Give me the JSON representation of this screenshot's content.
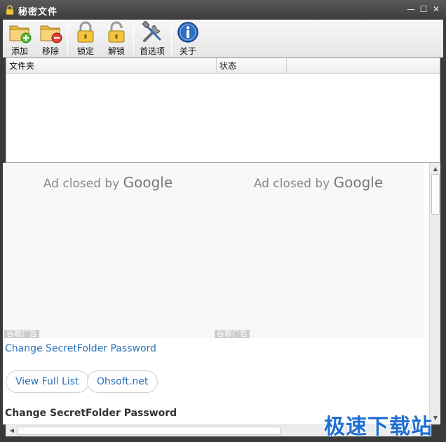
{
  "window": {
    "title": "秘密文件",
    "minimize": "—",
    "maximize": "☐",
    "close": "✕"
  },
  "toolbar": {
    "add_label": "添加",
    "remove_label": "移除",
    "lock_label": "锁定",
    "unlock_label": "解锁",
    "options_label": "首选项",
    "about_label": "关于"
  },
  "list": {
    "columns": [
      "文件夹",
      "状态"
    ],
    "rows": []
  },
  "web": {
    "ads": [
      {
        "text": "Ad closed by",
        "brand": "Google",
        "label": "谷歌广告"
      },
      {
        "text": "Ad closed by",
        "brand": "Google",
        "label": "谷歌广告"
      }
    ],
    "link_text": "Change SecretFolder Password",
    "buttons": [
      "View Full List",
      "Ohsoft.net"
    ],
    "heading": "Change SecretFolder Password"
  },
  "watermark": "极速下载站",
  "colors": {
    "titlebar": "#3c3c3c",
    "link": "#2b72b8",
    "watermark": "#1f6fd1"
  }
}
